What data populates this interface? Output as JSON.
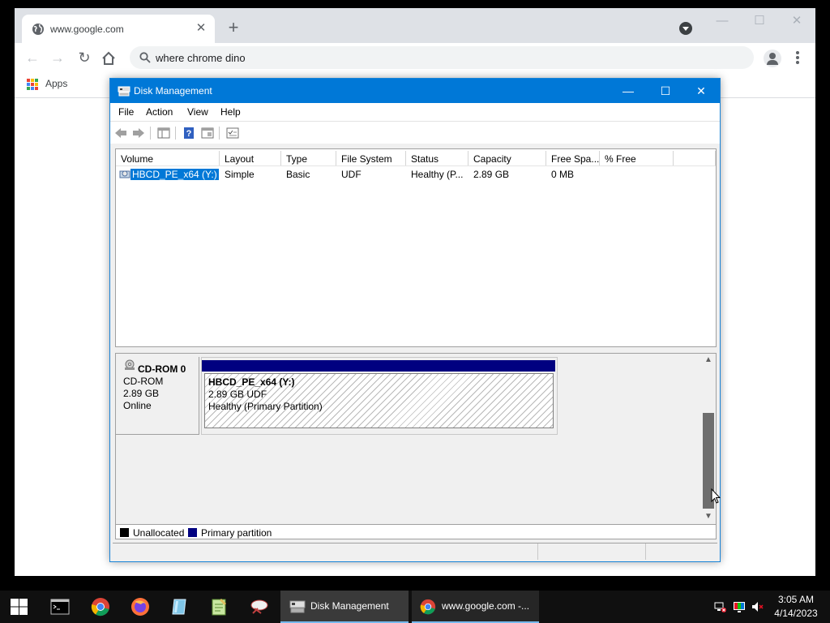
{
  "browser": {
    "tab_title": "www.google.com",
    "omnibox_text": "where chrome dino",
    "bookmarks": {
      "apps_label": "Apps"
    }
  },
  "disk_mgmt": {
    "title": "Disk Management",
    "menu": [
      "File",
      "Action",
      "View",
      "Help"
    ],
    "columns": [
      "Volume",
      "Layout",
      "Type",
      "File System",
      "Status",
      "Capacity",
      "Free Spa...",
      "% Free"
    ],
    "rows": [
      {
        "volume": "HBCD_PE_x64 (Y:)",
        "layout": "Simple",
        "type": "Basic",
        "file_system": "UDF",
        "status": "Healthy (P...",
        "capacity": "2.89 GB",
        "free_space": "0 MB",
        "pct_free": ""
      }
    ],
    "disk": {
      "name": "CD-ROM 0",
      "type": "CD-ROM",
      "size": "2.89 GB",
      "state": "Online",
      "partition": {
        "label": "HBCD_PE_x64  (Y:)",
        "size_fs": "2.89 GB UDF",
        "status": "Healthy (Primary Partition)"
      }
    },
    "legend": [
      {
        "label": "Unallocated",
        "color": "#000000"
      },
      {
        "label": "Primary partition",
        "color": "#000080"
      }
    ]
  },
  "taskbar": {
    "tasks": [
      {
        "label": "Disk Management",
        "icon": "disk-management-icon"
      },
      {
        "label": "www.google.com -...",
        "icon": "chrome-icon"
      }
    ],
    "clock": {
      "time": "3:05 AM",
      "date": "4/14/2023"
    }
  },
  "colors": {
    "accent": "#0078d7",
    "primary_partition": "#000080",
    "tab_strip": "#dee1e6"
  }
}
